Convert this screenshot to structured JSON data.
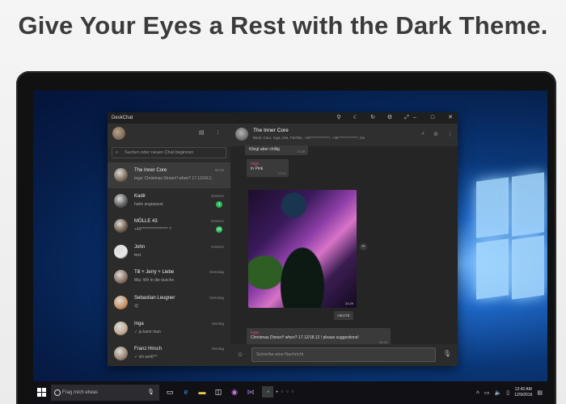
{
  "headline": "Give Your Eyes a Rest with the Dark Theme.",
  "window": {
    "title": "DeskChat",
    "toolbar_icons": [
      "pin-icon",
      "moon-icon",
      "refresh-icon",
      "gear-icon",
      "expand-icon"
    ],
    "controls": {
      "minimize": "–",
      "maximize": "□",
      "close": "✕"
    }
  },
  "sidebar": {
    "search_placeholder": "Suchen oder neuen Chat beginnen",
    "chats": [
      {
        "name": "The Inner Core",
        "preview": "Inga: Christmas Dinner!! when? 17.12/18.12 | …",
        "time": "00:15",
        "badge": "",
        "active": true,
        "avatar_color": "#7a6a5a"
      },
      {
        "name": "Kadir",
        "preview": "habe angepasst",
        "time": "Gestern",
        "badge": "3",
        "active": false,
        "avatar_color": "#5a5a5a"
      },
      {
        "name": "MÖLLE 43",
        "preview": "+49***************** ?",
        "time": "Gestern",
        "badge": "23",
        "active": false,
        "avatar_color": "#6b5a48"
      },
      {
        "name": "John",
        "preview": "test",
        "time": "Gestern",
        "badge": "",
        "active": false,
        "avatar_color": "#e8e8e8"
      },
      {
        "name": "Till + Jerry + Liebe",
        "preview": "Mia: Wir in die dusche",
        "time": "Dienstag",
        "badge": "",
        "active": false,
        "avatar_color": "#8a7060"
      },
      {
        "name": "Sebastian Leugner",
        "preview": "😊",
        "time": "Dienstag",
        "badge": "",
        "active": false,
        "avatar_color": "#c89060"
      },
      {
        "name": "Inga",
        "preview": "✓ ja kann man",
        "time": "Montag",
        "badge": "",
        "active": false,
        "avatar_color": "#c0a890"
      },
      {
        "name": "Franz Hirsch",
        "preview": "✓ ich weiß^^",
        "time": "Montag",
        "badge": "",
        "active": false,
        "avatar_color": "#9a8470"
      }
    ]
  },
  "conversation": {
    "name": "The Inner Core",
    "members": "Basti, Caro, Inga, Mia, Pachilo, +49**************, +49**************, Du",
    "messages": [
      {
        "sender": "",
        "text": "Klingt aber chillig",
        "time": "17:08"
      },
      {
        "sender": "Inga",
        "text": "In Pink",
        "time": "17:13"
      },
      {
        "photo_time": "21:29"
      },
      {
        "sender": "Inga",
        "text": "Christmas Dinner!! when? 17.12/18.12 ! please suggestions!",
        "time": "00:15"
      }
    ],
    "date_separator": "HEUTE",
    "compose_placeholder": "Schreibe eine Nachricht"
  },
  "taskbar": {
    "search_placeholder": "Frag mich etwas",
    "apps": [
      "task-view-icon",
      "edge-icon",
      "explorer-icon",
      "store-icon",
      "media-icon",
      "visual-studio-icon",
      "deskchat-icon"
    ],
    "time": "12:42 AM",
    "date": "12/9/2016"
  }
}
